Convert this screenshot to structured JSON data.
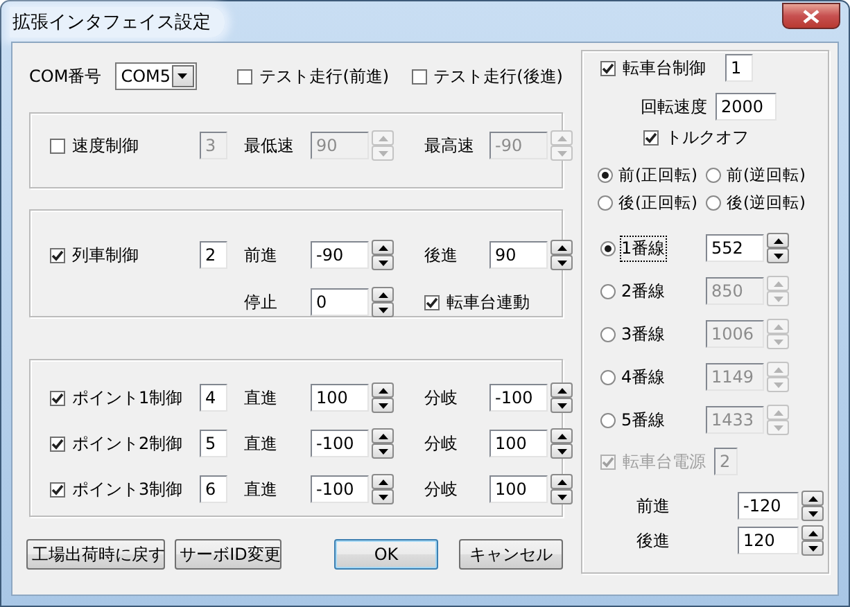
{
  "window": {
    "title": "拡張インタフェイス設定"
  },
  "com": {
    "label": "COM番号",
    "value": "COM5"
  },
  "test_runs": [
    {
      "label": "テスト走行(前進)",
      "checked": false
    },
    {
      "label": "テスト走行(後進)",
      "checked": false
    }
  ],
  "speed_control": {
    "label": "速度制御",
    "checked": false,
    "id": "3",
    "min_label": "最低速",
    "min_value": "90",
    "max_label": "最高速",
    "max_value": "-90"
  },
  "train_control": {
    "label": "列車制御",
    "checked": true,
    "id": "2",
    "forward_label": "前進",
    "forward_value": "-90",
    "backward_label": "後進",
    "backward_value": "90",
    "stop_label": "停止",
    "stop_value": "0",
    "turntable_link": {
      "label": "転車台連動",
      "checked": true
    }
  },
  "points": [
    {
      "label": "ポイント1制御",
      "checked": true,
      "id": "4",
      "straight_label": "直進",
      "straight_value": "100",
      "branch_label": "分岐",
      "branch_value": "-100"
    },
    {
      "label": "ポイント2制御",
      "checked": true,
      "id": "5",
      "straight_label": "直進",
      "straight_value": "-100",
      "branch_label": "分岐",
      "branch_value": "100"
    },
    {
      "label": "ポイント3制御",
      "checked": true,
      "id": "6",
      "straight_label": "直進",
      "straight_value": "-100",
      "branch_label": "分岐",
      "branch_value": "100"
    }
  ],
  "buttons": [
    {
      "label": "工場出荷時に戻す",
      "kind": "plain"
    },
    {
      "label": "サーボID変更",
      "kind": "plain"
    },
    {
      "label": "OK",
      "kind": "default"
    },
    {
      "label": "キャンセル",
      "kind": "plain"
    }
  ],
  "turntable": {
    "label": "転車台制御",
    "checked": true,
    "id": "1",
    "speed_label": "回転速度",
    "speed_value": "2000",
    "torque_off": {
      "label": "トルクオフ",
      "checked": true
    },
    "directions": [
      {
        "label": "前(正回転)",
        "selected": true
      },
      {
        "label": "前(逆回転)",
        "selected": false
      },
      {
        "label": "後(正回転)",
        "selected": false
      },
      {
        "label": "後(逆回転)",
        "selected": false
      }
    ],
    "tracks": [
      {
        "label": "1番線",
        "value": "552",
        "selected": true
      },
      {
        "label": "2番線",
        "value": "850",
        "selected": false
      },
      {
        "label": "3番線",
        "value": "1006",
        "selected": false
      },
      {
        "label": "4番線",
        "value": "1149",
        "selected": false
      },
      {
        "label": "5番線",
        "value": "1433",
        "selected": false
      }
    ],
    "power": {
      "label": "転車台電源",
      "checked": true,
      "disabled": true,
      "id": "2",
      "forward_label": "前進",
      "forward_value": "-120",
      "backward_label": "後進",
      "backward_value": "120"
    }
  }
}
